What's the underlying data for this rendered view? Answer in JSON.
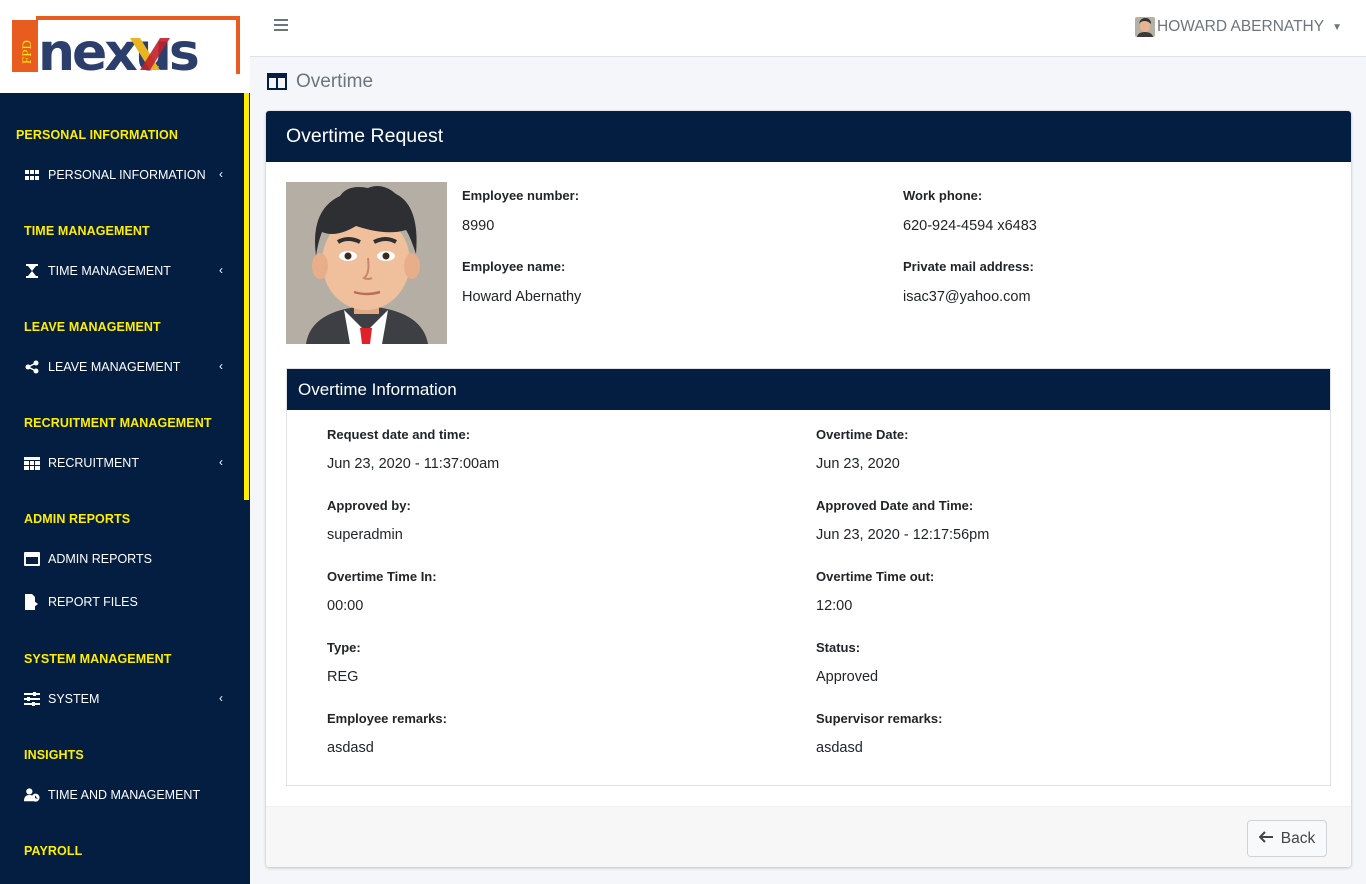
{
  "logo": {
    "text": "nexus",
    "sub": "FPD"
  },
  "sidebar": {
    "sections": [
      {
        "title": "PERSONAL INFORMATION",
        "items": [
          {
            "label": "PERSONAL INFORMATION",
            "icon": "grid-icon",
            "chevron": "‹"
          }
        ]
      },
      {
        "title": "TIME MANAGEMENT",
        "items": [
          {
            "label": "TIME MANAGEMENT",
            "icon": "hourglass-icon",
            "chevron": "‹"
          }
        ]
      },
      {
        "title": "LEAVE MANAGEMENT",
        "items": [
          {
            "label": "LEAVE MANAGEMENT",
            "icon": "share-icon",
            "chevron": "‹"
          }
        ]
      },
      {
        "title": "RECRUITMENT MANAGEMENT",
        "items": [
          {
            "label": "RECRUITMENT",
            "icon": "table-icon",
            "chevron": "‹"
          }
        ]
      },
      {
        "title": "ADMIN REPORTS",
        "items": [
          {
            "label": "ADMIN REPORTS",
            "icon": "window-icon"
          },
          {
            "label": "REPORT FILES",
            "icon": "file-export-icon"
          }
        ]
      },
      {
        "title": "SYSTEM MANAGEMENT",
        "items": [
          {
            "label": "SYSTEM",
            "icon": "sliders-icon",
            "chevron": "‹"
          }
        ]
      },
      {
        "title": "INSIGHTS",
        "items": [
          {
            "label": "TIME AND MANAGEMENT",
            "icon": "user-clock-icon"
          }
        ]
      },
      {
        "title": "PAYROLL",
        "items": []
      }
    ]
  },
  "topbar": {
    "user_name": "HOWARD ABERNATHY",
    "caret": "▼"
  },
  "page": {
    "title": "Overtime"
  },
  "card": {
    "title": "Overtime Request",
    "employee": {
      "number_label": "Employee number:",
      "number": "8990",
      "name_label": "Employee name:",
      "name": "Howard Abernathy",
      "phone_label": "Work phone:",
      "phone": "620-924-4594 x6483",
      "email_label": "Private mail address:",
      "email": "isac37@yahoo.com"
    },
    "overtime": {
      "title": "Overtime Information",
      "fields": [
        {
          "label": "Request date and time:",
          "value": "Jun 23, 2020 - 11:37:00am"
        },
        {
          "label": "Overtime Date:",
          "value": "Jun 23, 2020"
        },
        {
          "label": "Approved by:",
          "value": "superadmin"
        },
        {
          "label": "Approved Date and Time:",
          "value": "Jun 23, 2020 - 12:17:56pm"
        },
        {
          "label": "Overtime Time In:",
          "value": "00:00"
        },
        {
          "label": "Overtime Time out:",
          "value": "12:00"
        },
        {
          "label": "Type:",
          "value": "REG"
        },
        {
          "label": "Status:",
          "value": "Approved"
        },
        {
          "label": "Employee remarks:",
          "value": "asdasd"
        },
        {
          "label": "Supervisor remarks:",
          "value": "asdasd"
        }
      ]
    },
    "back_label": "Back"
  },
  "colors": {
    "navy": "#041e42",
    "accent_yellow": "#ffee00",
    "logo_orange": "#e85d1f"
  }
}
